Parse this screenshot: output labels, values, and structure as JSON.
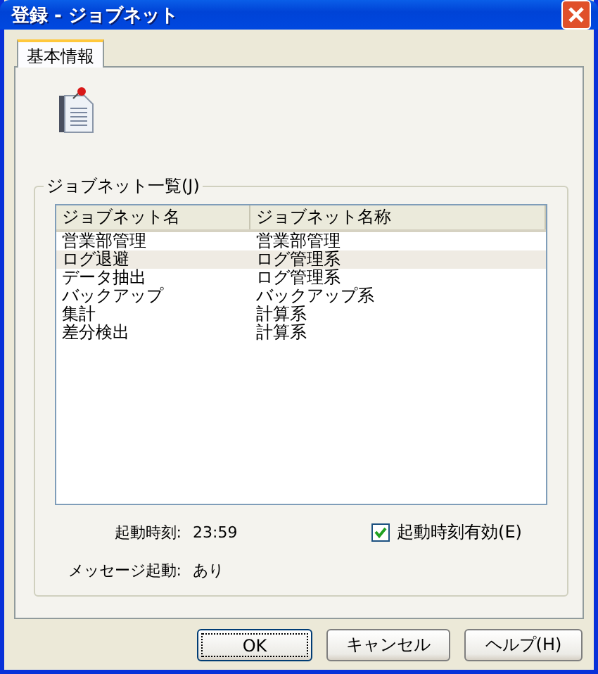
{
  "window": {
    "title": "登録 - ジョブネット"
  },
  "tabs": [
    {
      "label": "基本情報",
      "selected": true
    }
  ],
  "group": {
    "title": "ジョブネット一覧(J)"
  },
  "table": {
    "columns": [
      "ジョブネット名",
      "ジョブネット名称"
    ],
    "rows": [
      {
        "cells": [
          "営業部管理",
          "営業部管理"
        ],
        "selected": false
      },
      {
        "cells": [
          "ログ退避",
          "ログ管理系"
        ],
        "selected": true
      },
      {
        "cells": [
          "データ抽出",
          "ログ管理系"
        ],
        "selected": false
      },
      {
        "cells": [
          "バックアップ",
          "バックアップ系"
        ],
        "selected": false
      },
      {
        "cells": [
          "集計",
          "計算系"
        ],
        "selected": false
      },
      {
        "cells": [
          "差分検出",
          "計算系"
        ],
        "selected": false
      }
    ]
  },
  "start_time": {
    "label": "起動時刻:",
    "value": "23:59"
  },
  "start_time_enabled": {
    "label": "起動時刻有効(E)",
    "checked": true
  },
  "message_start": {
    "label": "メッセージ起動:",
    "value": "あり"
  },
  "buttons": [
    {
      "label": "OK",
      "default": true
    },
    {
      "label": "キャンセル",
      "default": false
    },
    {
      "label": "ヘルプ(H)",
      "default": false
    }
  ]
}
